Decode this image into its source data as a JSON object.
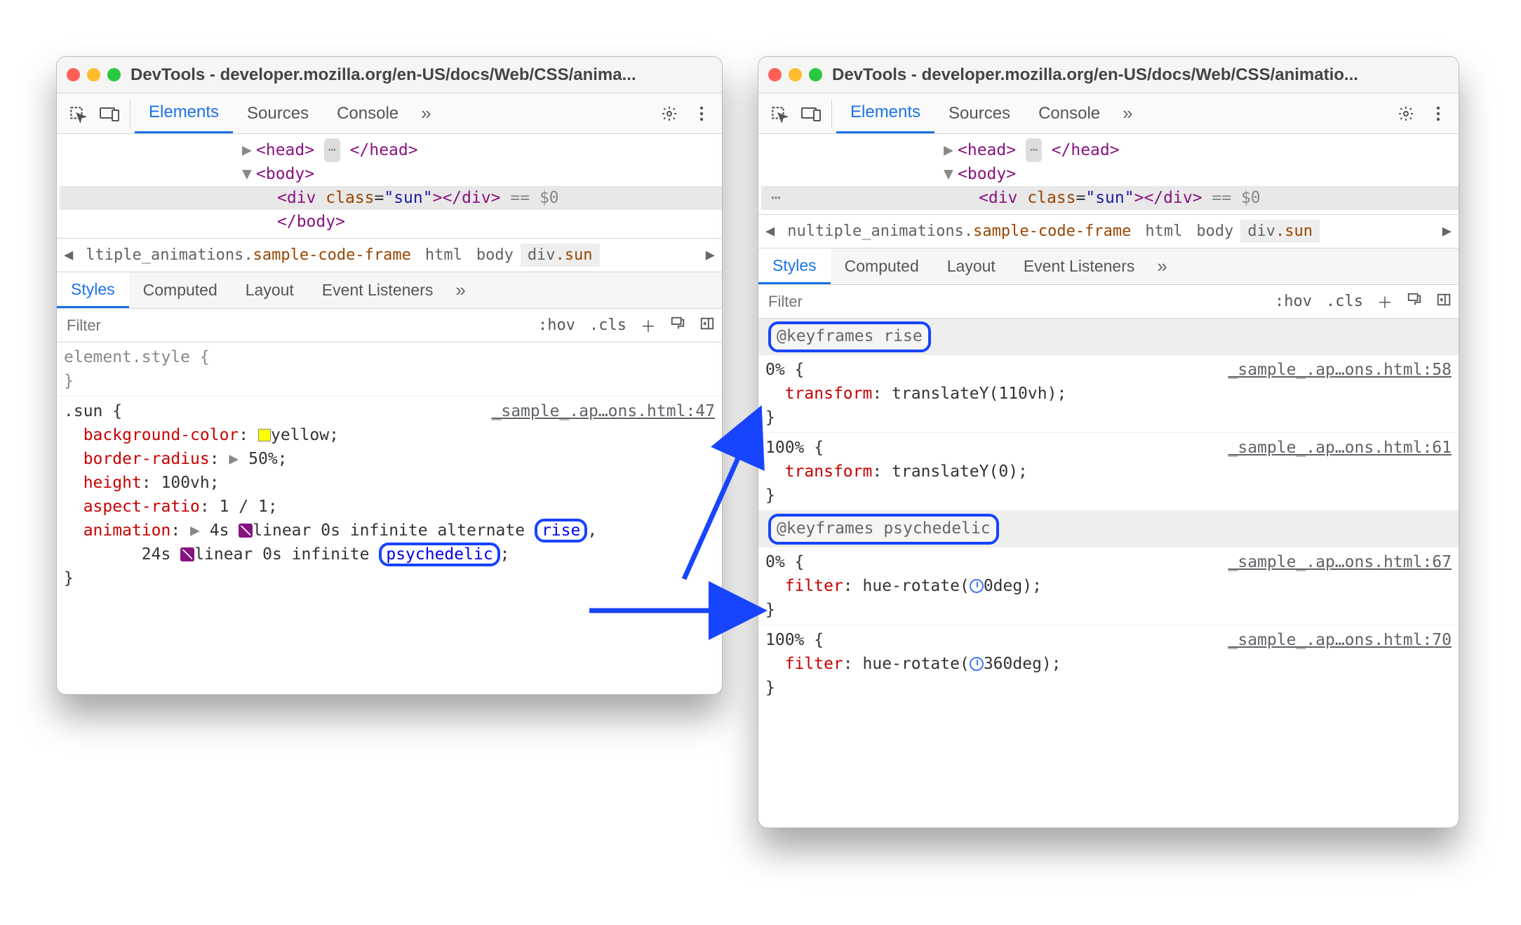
{
  "left": {
    "title": "DevTools - developer.mozilla.org/en-US/docs/Web/CSS/anima...",
    "tabs": {
      "elements": "Elements",
      "sources": "Sources",
      "console": "Console"
    },
    "dom": {
      "head_open": "<head>",
      "head_pill": "⋯",
      "head_close": "</head>",
      "body_open": "<body>",
      "div_tag_open": "<div",
      "div_class_attr": "class",
      "div_class_val": "\"sun\"",
      "div_close_open": "></div>",
      "eq0": "== $0",
      "body_close": "</body>"
    },
    "crumbs": {
      "c0": "ltiple_animations.",
      "c0cls": "sample-code-frame",
      "c1": "html",
      "c2": "body",
      "c3raw": "div",
      "c3cls": ".sun"
    },
    "subtabs": {
      "styles": "Styles",
      "computed": "Computed",
      "layout": "Layout",
      "events": "Event Listeners"
    },
    "filter": {
      "placeholder": "Filter",
      "hov": ":hov",
      "cls": ".cls"
    },
    "rules": {
      "elstyle": "element.style {",
      "sun_sel": ".sun {",
      "sun_src": "_sample_.ap…ons.html:47",
      "bg_prop": "background-color",
      "bg_val": "yellow",
      "br_prop": "border-radius",
      "br_val": "50%",
      "h_prop": "height",
      "h_val": "100vh",
      "ar_prop": "aspect-ratio",
      "ar_val": "1 / 1",
      "anim_prop": "animation",
      "a1_dur": "4s",
      "a1_tf": "linear",
      "a1_delay": "0s",
      "a1_iter": "infinite",
      "a1_dir": "alternate",
      "a1_name": "rise",
      "a2_dur": "24s",
      "a2_tf": "linear",
      "a2_delay": "0s",
      "a2_iter": "infinite",
      "a2_name": "psychedelic"
    }
  },
  "right": {
    "title": "DevTools - developer.mozilla.org/en-US/docs/Web/CSS/animatio...",
    "tabs": {
      "elements": "Elements",
      "sources": "Sources",
      "console": "Console"
    },
    "dom": {
      "head_open": "<head>",
      "head_pill": "⋯",
      "head_close": "</head>",
      "body_open": "<body>",
      "div_tag_open": "<div",
      "div_class_attr": "class",
      "div_class_val": "\"sun\"",
      "div_close_open": "></div>",
      "eq0": "== $0"
    },
    "crumbs": {
      "c0": "nultiple_animations.",
      "c0cls": "sample-code-frame",
      "c1": "html",
      "c2": "body",
      "c3raw": "div",
      "c3cls": ".sun"
    },
    "subtabs": {
      "styles": "Styles",
      "computed": "Computed",
      "layout": "Layout",
      "events": "Event Listeners"
    },
    "filter": {
      "placeholder": "Filter",
      "hov": ":hov",
      "cls": ".cls"
    },
    "kf": {
      "rise_head": "@keyframes rise",
      "rise_0_open": "0% {",
      "rise_0_src": "_sample_.ap…ons.html:58",
      "rise_0_prop": "transform",
      "rise_0_val": "translateY(110vh)",
      "rise_100_open": "100% {",
      "rise_100_src": "_sample_.ap…ons.html:61",
      "rise_100_prop": "transform",
      "rise_100_val": "translateY(0)",
      "psy_head": "@keyframes psychedelic",
      "psy_0_open": "0% {",
      "psy_0_src": "_sample_.ap…ons.html:67",
      "psy_0_prop": "filter",
      "psy_0_val_pre": "hue-rotate(",
      "psy_0_val_post": "0deg)",
      "psy_100_open": "100% {",
      "psy_100_src": "_sample_.ap…ons.html:70",
      "psy_100_prop": "filter",
      "psy_100_val_pre": "hue-rotate(",
      "psy_100_val_post": "360deg)"
    }
  }
}
